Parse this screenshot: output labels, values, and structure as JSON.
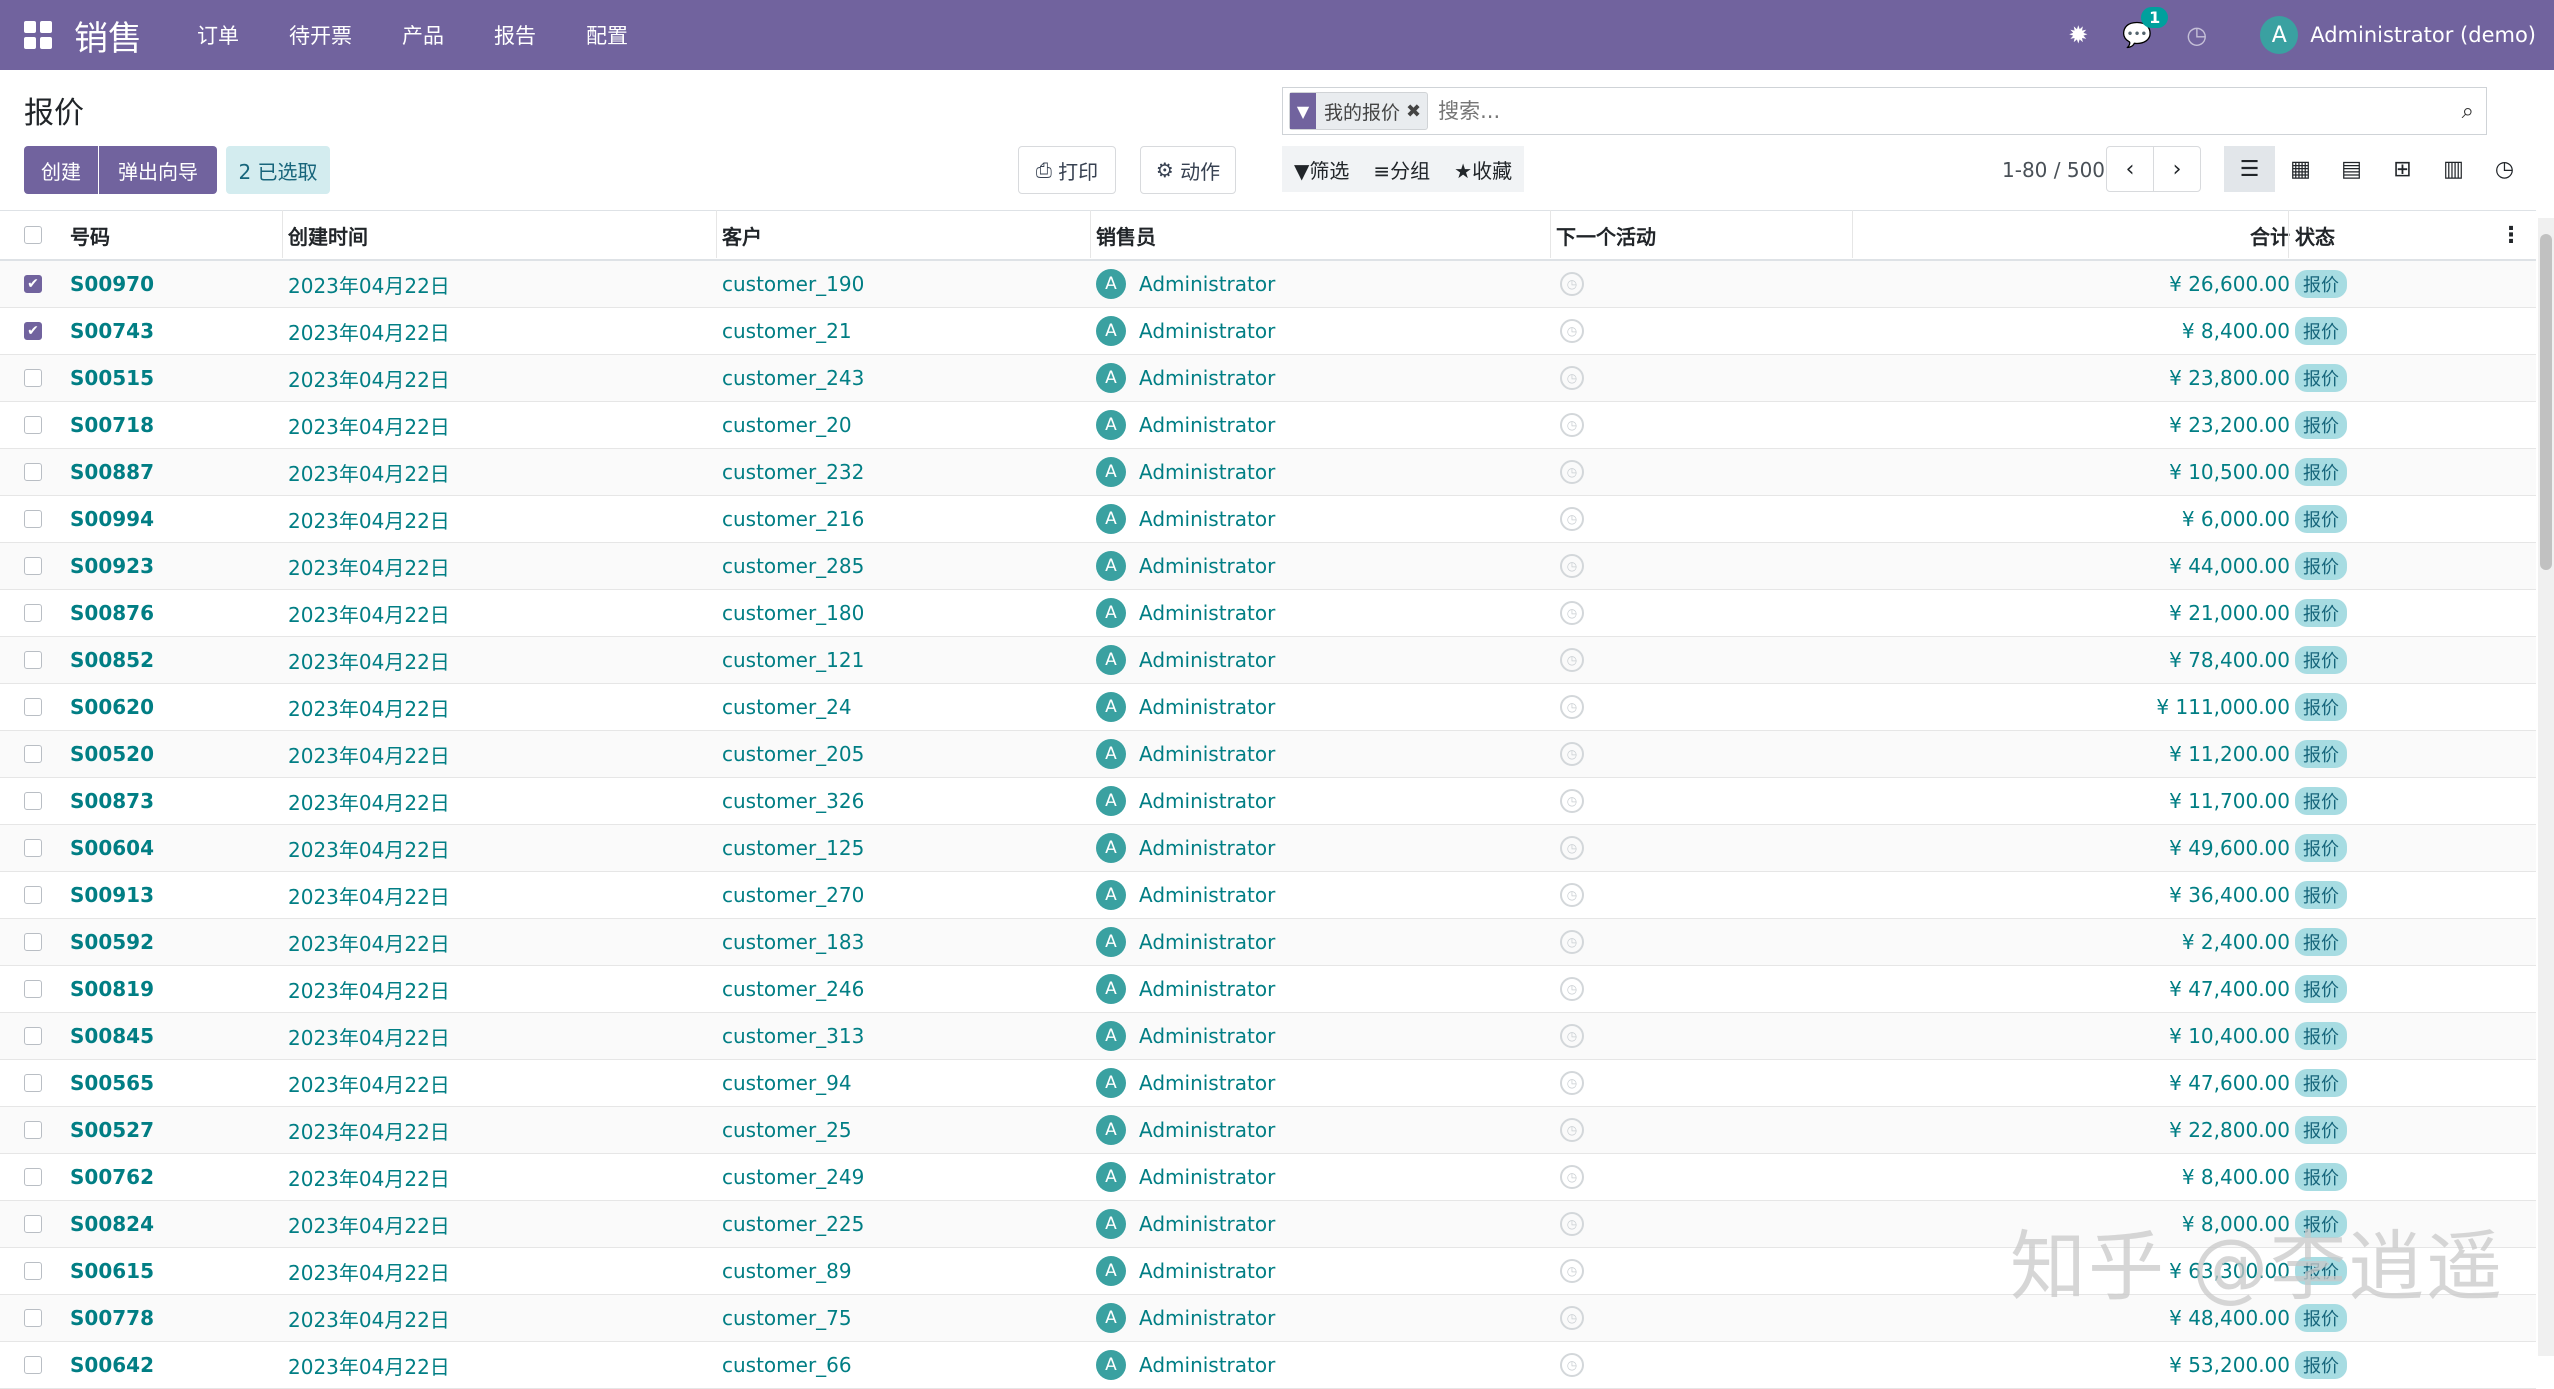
{
  "app": {
    "title": "销售",
    "menu": [
      "订单",
      "待开票",
      "产品",
      "报告",
      "配置"
    ],
    "chat_badge": "1",
    "avatar_letter": "A",
    "user": "Administrator (demo)"
  },
  "page": {
    "title": "报价"
  },
  "buttons": {
    "create": "创建",
    "wizard": "弹出向导",
    "selected": "2 已选取",
    "print": "打印",
    "action": "动作"
  },
  "search": {
    "facet": "我的报价",
    "placeholder": "搜索..."
  },
  "filters": {
    "filter": "筛选",
    "group": "分组",
    "favorites": "收藏"
  },
  "pager": {
    "range": "1-80 / 500"
  },
  "columns": {
    "number": "号码",
    "created": "创建时间",
    "customer": "客户",
    "salesperson": "销售员",
    "activity": "下一个活动",
    "total": "合计",
    "status": "状态"
  },
  "rows": [
    {
      "checked": true,
      "number": "S00970",
      "date": "2023年04月22日",
      "customer": "customer_190",
      "sp": "Administrator",
      "total": "¥ 26,600.00",
      "status": "报价"
    },
    {
      "checked": true,
      "number": "S00743",
      "date": "2023年04月22日",
      "customer": "customer_21",
      "sp": "Administrator",
      "total": "¥ 8,400.00",
      "status": "报价"
    },
    {
      "checked": false,
      "number": "S00515",
      "date": "2023年04月22日",
      "customer": "customer_243",
      "sp": "Administrator",
      "total": "¥ 23,800.00",
      "status": "报价"
    },
    {
      "checked": false,
      "number": "S00718",
      "date": "2023年04月22日",
      "customer": "customer_20",
      "sp": "Administrator",
      "total": "¥ 23,200.00",
      "status": "报价"
    },
    {
      "checked": false,
      "number": "S00887",
      "date": "2023年04月22日",
      "customer": "customer_232",
      "sp": "Administrator",
      "total": "¥ 10,500.00",
      "status": "报价"
    },
    {
      "checked": false,
      "number": "S00994",
      "date": "2023年04月22日",
      "customer": "customer_216",
      "sp": "Administrator",
      "total": "¥ 6,000.00",
      "status": "报价"
    },
    {
      "checked": false,
      "number": "S00923",
      "date": "2023年04月22日",
      "customer": "customer_285",
      "sp": "Administrator",
      "total": "¥ 44,000.00",
      "status": "报价"
    },
    {
      "checked": false,
      "number": "S00876",
      "date": "2023年04月22日",
      "customer": "customer_180",
      "sp": "Administrator",
      "total": "¥ 21,000.00",
      "status": "报价"
    },
    {
      "checked": false,
      "number": "S00852",
      "date": "2023年04月22日",
      "customer": "customer_121",
      "sp": "Administrator",
      "total": "¥ 78,400.00",
      "status": "报价"
    },
    {
      "checked": false,
      "number": "S00620",
      "date": "2023年04月22日",
      "customer": "customer_24",
      "sp": "Administrator",
      "total": "¥ 111,000.00",
      "status": "报价"
    },
    {
      "checked": false,
      "number": "S00520",
      "date": "2023年04月22日",
      "customer": "customer_205",
      "sp": "Administrator",
      "total": "¥ 11,200.00",
      "status": "报价"
    },
    {
      "checked": false,
      "number": "S00873",
      "date": "2023年04月22日",
      "customer": "customer_326",
      "sp": "Administrator",
      "total": "¥ 11,700.00",
      "status": "报价"
    },
    {
      "checked": false,
      "number": "S00604",
      "date": "2023年04月22日",
      "customer": "customer_125",
      "sp": "Administrator",
      "total": "¥ 49,600.00",
      "status": "报价"
    },
    {
      "checked": false,
      "number": "S00913",
      "date": "2023年04月22日",
      "customer": "customer_270",
      "sp": "Administrator",
      "total": "¥ 36,400.00",
      "status": "报价"
    },
    {
      "checked": false,
      "number": "S00592",
      "date": "2023年04月22日",
      "customer": "customer_183",
      "sp": "Administrator",
      "total": "¥ 2,400.00",
      "status": "报价"
    },
    {
      "checked": false,
      "number": "S00819",
      "date": "2023年04月22日",
      "customer": "customer_246",
      "sp": "Administrator",
      "total": "¥ 47,400.00",
      "status": "报价"
    },
    {
      "checked": false,
      "number": "S00845",
      "date": "2023年04月22日",
      "customer": "customer_313",
      "sp": "Administrator",
      "total": "¥ 10,400.00",
      "status": "报价"
    },
    {
      "checked": false,
      "number": "S00565",
      "date": "2023年04月22日",
      "customer": "customer_94",
      "sp": "Administrator",
      "total": "¥ 47,600.00",
      "status": "报价"
    },
    {
      "checked": false,
      "number": "S00527",
      "date": "2023年04月22日",
      "customer": "customer_25",
      "sp": "Administrator",
      "total": "¥ 22,800.00",
      "status": "报价"
    },
    {
      "checked": false,
      "number": "S00762",
      "date": "2023年04月22日",
      "customer": "customer_249",
      "sp": "Administrator",
      "total": "¥ 8,400.00",
      "status": "报价"
    },
    {
      "checked": false,
      "number": "S00824",
      "date": "2023年04月22日",
      "customer": "customer_225",
      "sp": "Administrator",
      "total": "¥ 8,000.00",
      "status": "报价"
    },
    {
      "checked": false,
      "number": "S00615",
      "date": "2023年04月22日",
      "customer": "customer_89",
      "sp": "Administrator",
      "total": "¥ 63,300.00",
      "status": "报价"
    },
    {
      "checked": false,
      "number": "S00778",
      "date": "2023年04月22日",
      "customer": "customer_75",
      "sp": "Administrator",
      "total": "¥ 48,400.00",
      "status": "报价"
    },
    {
      "checked": false,
      "number": "S00642",
      "date": "2023年04月22日",
      "customer": "customer_66",
      "sp": "Administrator",
      "total": "¥ 53,200.00",
      "status": "报价"
    }
  ],
  "watermark": "知乎 @李逍遥",
  "colors": {
    "navbar": "#71639e",
    "link": "#017e84",
    "badge": "#a7dce2"
  }
}
